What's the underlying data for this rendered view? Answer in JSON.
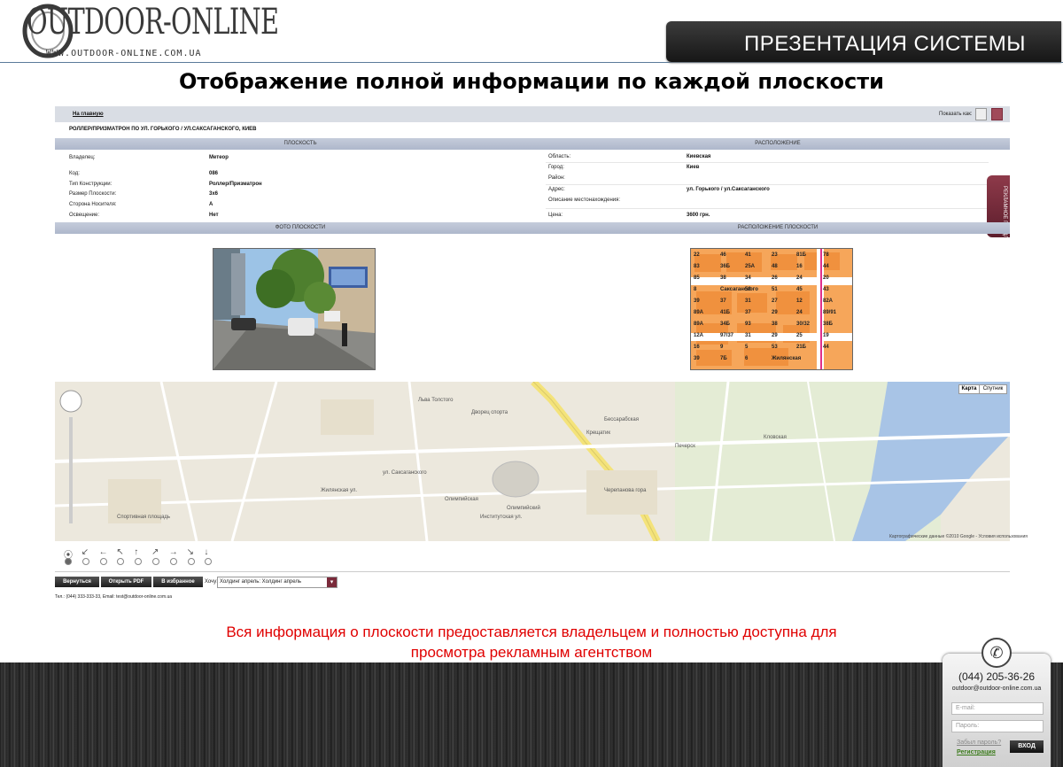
{
  "header": {
    "logo_word": "OUTDOOR-ONLINE",
    "logo_url": "WWW.OUTDOOR-ONLINE.COM.UA",
    "presentation_title": "ПРЕЗЕНТАЦИЯ СИСТЕМЫ"
  },
  "slide_title": "Отображение полной информации по каждой плоскости",
  "app": {
    "home_link": "На главную",
    "show_as": "Показать как:",
    "address_title": "РОЛЛЕР/ПРИЗМАТРОН ПО УЛ. ГОРЬКОГО / УЛ.САКСАГАНСКОГО, КИЕВ",
    "section_plane": "ПЛОСКОСТЬ",
    "section_location": "РАСПОЛОЖЕНИЕ",
    "section_photo": "ФОТО ПЛОСКОСТИ",
    "section_map": "РАСПОЛОЖЕНИЕ ПЛОСКОСТИ",
    "side_tab": "РЕКЛАМНОЕ ПРЕДЛОЖЕНИЕ",
    "left_fields": [
      {
        "label": "Владелец:",
        "value": "Метеор"
      },
      {
        "label": "Код:",
        "value": "086"
      },
      {
        "label": "Тип Конструкции:",
        "value": "Роллер/Призматрон"
      },
      {
        "label": "Размер Плоскости:",
        "value": "3х6"
      },
      {
        "label": "Сторона Носителя:",
        "value": "А"
      },
      {
        "label": "Освещение:",
        "value": "Нет"
      }
    ],
    "right_fields": [
      {
        "label": "Область:",
        "value": "Киевская"
      },
      {
        "label": "Город:",
        "value": "Киев"
      },
      {
        "label": "Район:",
        "value": ""
      },
      {
        "label": "Адрес:",
        "value": "ул. Горького / ул.Саксаганского"
      },
      {
        "label": "Описание местонахождения:",
        "value": ""
      },
      {
        "label": "Цена:",
        "value": "3600 грн."
      }
    ],
    "map_buttons": {
      "map": "Карта",
      "satellite": "Спутник"
    },
    "map_copyright": "Картографические данные ©2010 Google - Условия использования",
    "arrows": [
      "⦿",
      "↙",
      "←",
      "↖",
      "↑",
      "↗",
      "→",
      "↘",
      "↓"
    ],
    "buttons": {
      "back": "Вернуться",
      "pdf": "Открыть PDF",
      "favorites": "В избранное"
    },
    "tab_label": "Хочу:",
    "select_value": "Холдинг апрель:   Холдинг апрель",
    "contacts_line": "Тел.: (044) 333-333-33,  Email: test@outdoor-online.com.ua"
  },
  "caption": {
    "line1": "Вся информация  о плоскости  предоставляется владельцем и полностью доступна для",
    "line2": "просмотра рекламным  агентством"
  },
  "contact_box": {
    "phone": "(044) 205-36-26",
    "email": "outdoor@outdoor-online.com.ua",
    "email_placeholder": "E-mail:",
    "password_placeholder": "Пароль:",
    "forgot": "Забыл пароль?",
    "register": "Регистрация",
    "login": "ВХОД"
  },
  "map_thumb_labels": [
    "22",
    "46",
    "41",
    "23",
    "81Б",
    "78",
    "83",
    "36Б",
    "25А",
    "48",
    "16",
    "44",
    "85",
    "38",
    "34",
    "26",
    "24",
    "20",
    "8",
    "Саксаганского",
    "53",
    "51",
    "45",
    "43",
    "39",
    "37",
    "31",
    "27",
    "12",
    "82А",
    "89А",
    "41Б",
    "37",
    "29",
    "24",
    "89/91",
    "89А",
    "34Б",
    "93",
    "38",
    "30/32",
    "38Б",
    "12А",
    "97/37",
    "31",
    "29",
    "25",
    "19",
    "16",
    "9",
    "5",
    "53",
    "21Б",
    "44",
    "39",
    "7Б",
    "6",
    "Жилянская"
  ],
  "big_map_labels": [
    "Льва Толстого",
    "Дворец спорта",
    "Олимпийская",
    "Бессарабская",
    "Крещатик",
    "Кловская",
    "Печерск",
    "ул. Саксаганского",
    "Жилянская ул.",
    "Спортивная площадь",
    "Институтская ул.",
    "Черепанова гора",
    "Олимпийский"
  ],
  "colors": {
    "accent_red": "#e00000",
    "header_blue": "#aeb7cb",
    "tab_maroon": "#7a2a3a"
  }
}
